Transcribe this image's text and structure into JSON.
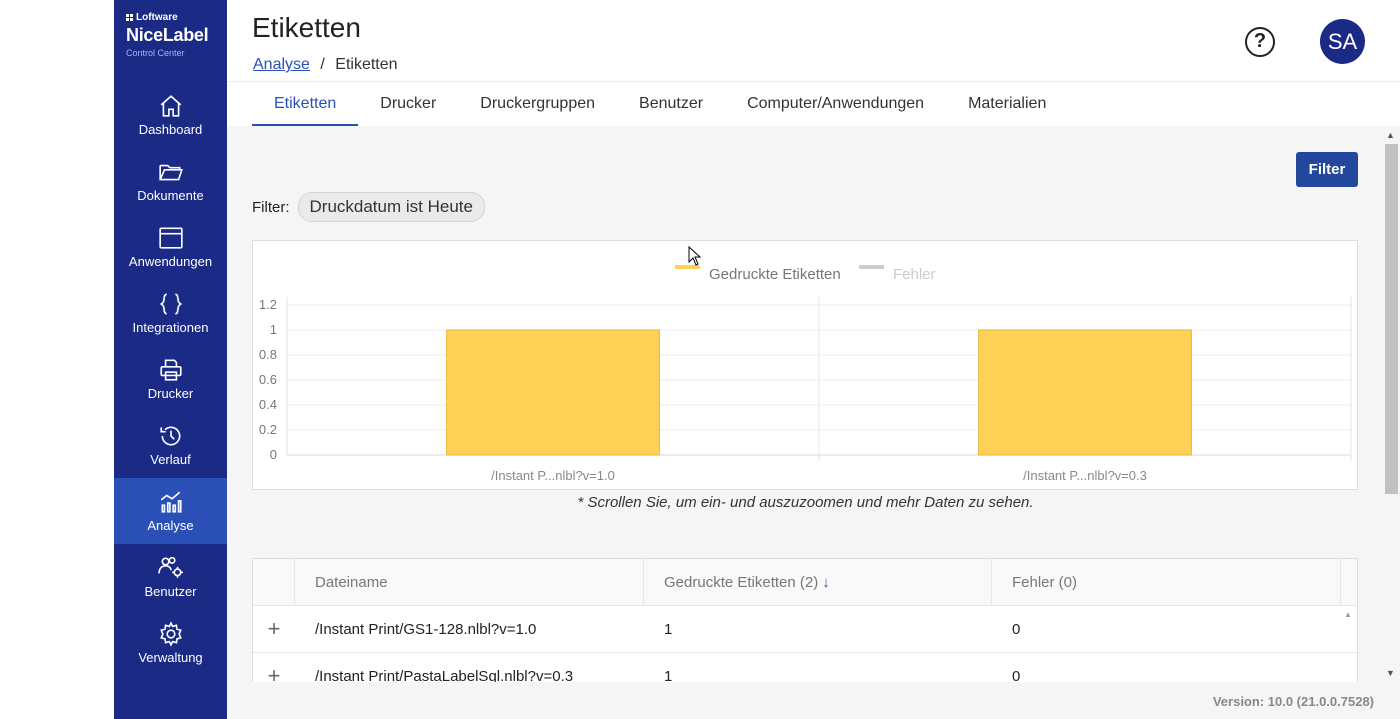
{
  "brand": {
    "company": "Loftware",
    "product": "NiceLabel",
    "subtitle": "Control Center"
  },
  "sidebar": {
    "items": [
      {
        "label": "Dashboard",
        "icon": "home-icon"
      },
      {
        "label": "Dokumente",
        "icon": "folder-icon"
      },
      {
        "label": "Anwendungen",
        "icon": "window-icon"
      },
      {
        "label": "Integrationen",
        "icon": "braces-icon"
      },
      {
        "label": "Drucker",
        "icon": "printer-icon"
      },
      {
        "label": "Verlauf",
        "icon": "history-icon"
      },
      {
        "label": "Analyse",
        "icon": "analytics-icon",
        "active": true
      },
      {
        "label": "Benutzer",
        "icon": "users-gear-icon"
      },
      {
        "label": "Verwaltung",
        "icon": "gear-icon"
      }
    ]
  },
  "header": {
    "title": "Etiketten",
    "breadcrumb_link": "Analyse",
    "breadcrumb_sep": "/",
    "breadcrumb_current": "Etiketten",
    "help": "?",
    "avatar": "SA"
  },
  "tabs": [
    "Etiketten",
    "Drucker",
    "Druckergruppen",
    "Benutzer",
    "Computer/Anwendungen",
    "Materialien"
  ],
  "toolbar": {
    "filter_button": "Filter"
  },
  "filter": {
    "label": "Filter:",
    "chip": "Druckdatum ist Heute"
  },
  "chart_data": {
    "type": "bar",
    "categories": [
      "/Instant P...nlbl?v=1.0",
      "/Instant P...nlbl?v=0.3"
    ],
    "series": [
      {
        "name": "Gedruckte Etiketten",
        "values": [
          1,
          1
        ],
        "color": "#ffd256"
      },
      {
        "name": "Fehler",
        "values": [
          0,
          0
        ],
        "color": "#cccccc"
      }
    ],
    "yticks": [
      "0",
      "0.2",
      "0.4",
      "0.6",
      "0.8",
      "1",
      "1.2"
    ],
    "ylim": [
      0,
      1.2
    ],
    "legend": "top-center"
  },
  "chart_note": "* Scrollen Sie, um ein- und auszuzoomen und mehr Daten zu sehen.",
  "table": {
    "headers": [
      "Dateiname",
      "Gedruckte Etiketten (2)",
      "Fehler (0)"
    ],
    "rows": [
      {
        "expand": "+",
        "file": "/Instant Print/GS1-128.nlbl?v=1.0",
        "printed": "1",
        "errors": "0"
      },
      {
        "expand": "+",
        "file": "/Instant Print/PastaLabelSql.nlbl?v=0.3",
        "printed": "1",
        "errors": "0"
      }
    ]
  },
  "footer": {
    "version": "Version: 10.0 (21.0.0.7528)"
  }
}
